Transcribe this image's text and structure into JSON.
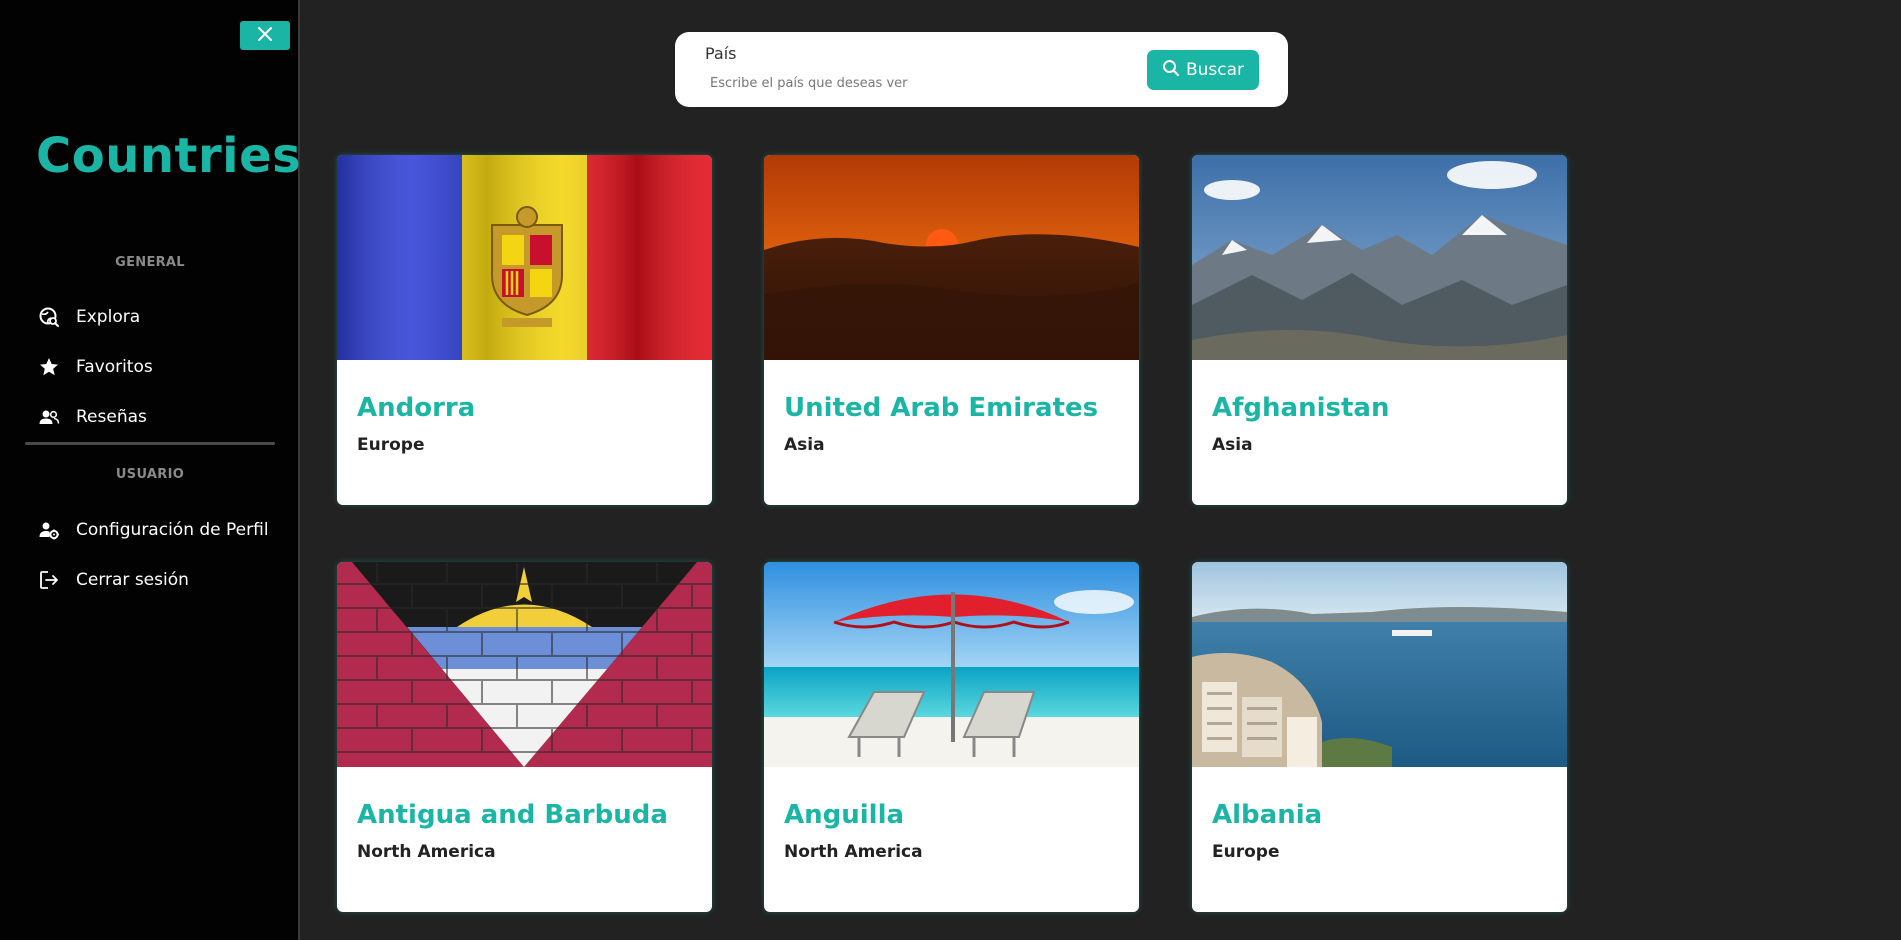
{
  "sidebar": {
    "brand": "Countries",
    "section_general": "GENERAL",
    "section_user": "USUARIO",
    "general_items": [
      {
        "label": "Explora",
        "icon": "explore-globe-icon"
      },
      {
        "label": "Favoritos",
        "icon": "star-icon"
      },
      {
        "label": "Reseñas",
        "icon": "users-icon"
      }
    ],
    "user_items": [
      {
        "label": "Configuración de Perfil",
        "icon": "user-settings-icon"
      },
      {
        "label": "Cerrar sesión",
        "icon": "logout-icon"
      }
    ]
  },
  "search": {
    "label": "País",
    "placeholder": "Escribe el país que deseas ver",
    "button_label": "Buscar"
  },
  "colors": {
    "accent": "#1bb5a5",
    "sidebar_bg": "#020202",
    "main_bg": "#222222"
  },
  "countries": [
    {
      "name": "Andorra",
      "region": "Europe",
      "image": "andorra-flag-image"
    },
    {
      "name": "United Arab Emirates",
      "region": "Asia",
      "image": "desert-sunset-image"
    },
    {
      "name": "Afghanistan",
      "region": "Asia",
      "image": "mountains-image"
    },
    {
      "name": "Antigua and Barbuda",
      "region": "North America",
      "image": "antigua-flag-wall-image"
    },
    {
      "name": "Anguilla",
      "region": "North America",
      "image": "beach-umbrella-image"
    },
    {
      "name": "Albania",
      "region": "Europe",
      "image": "coastal-city-image"
    }
  ]
}
